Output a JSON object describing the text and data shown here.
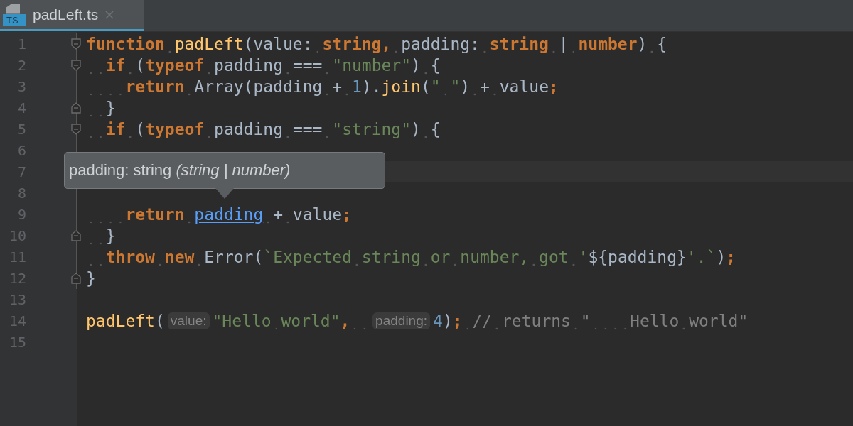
{
  "tabs": [
    {
      "label": "padLeft.ts",
      "icon": "TS",
      "selected": true
    }
  ],
  "lines": [
    {
      "number": "1",
      "fold_start": true,
      "tokens": [
        {
          "text": "function ",
          "kind": "keyword"
        },
        {
          "text": "padLeft",
          "kind": "function"
        },
        {
          "text": "(value: ",
          "kind": "plain"
        },
        {
          "text": "string, ",
          "kind": "keyword"
        },
        {
          "text": "padding: ",
          "kind": "plain"
        },
        {
          "text": "string ",
          "kind": "keyword"
        },
        {
          "text": "| ",
          "kind": "plain"
        },
        {
          "text": "number",
          "kind": "keyword"
        },
        {
          "text": ") {",
          "kind": "plain"
        }
      ]
    },
    {
      "number": "2",
      "fold_start": true,
      "tokens": [
        {
          "text": "  if ",
          "kind": "keyword"
        },
        {
          "text": "(",
          "kind": "plain"
        },
        {
          "text": "typeof ",
          "kind": "keyword"
        },
        {
          "text": "padding === ",
          "kind": "plain"
        },
        {
          "text": "\"number\"",
          "kind": "string"
        },
        {
          "text": ") {",
          "kind": "plain"
        }
      ]
    },
    {
      "number": "3",
      "tokens": [
        {
          "text": "    return ",
          "kind": "keyword"
        },
        {
          "text": "Array(padding + ",
          "kind": "plain"
        },
        {
          "text": "1",
          "kind": "number"
        },
        {
          "text": ").",
          "kind": "plain"
        },
        {
          "text": "join",
          "kind": "function"
        },
        {
          "text": "(",
          "kind": "plain"
        },
        {
          "text": "\" \"",
          "kind": "string"
        },
        {
          "text": ") + value",
          "kind": "plain"
        },
        {
          "text": ";",
          "kind": "keyword"
        }
      ]
    },
    {
      "number": "4",
      "fold_end": true,
      "tokens": [
        {
          "text": "  }",
          "kind": "plain"
        }
      ]
    },
    {
      "number": "5",
      "fold_start": true,
      "tokens": [
        {
          "text": "  if ",
          "kind": "keyword"
        },
        {
          "text": "(",
          "kind": "plain"
        },
        {
          "text": "typeof ",
          "kind": "keyword"
        },
        {
          "text": "padding === ",
          "kind": "plain"
        },
        {
          "text": "\"string\"",
          "kind": "string"
        },
        {
          "text": ") {",
          "kind": "plain"
        }
      ]
    },
    {
      "number": "6"
    },
    {
      "number": "7",
      "current": true
    },
    {
      "number": "8"
    },
    {
      "number": "9",
      "tokens": [
        {
          "text": "    return ",
          "kind": "keyword"
        },
        {
          "text": "padding",
          "kind": "link"
        },
        {
          "text": " + value",
          "kind": "plain"
        },
        {
          "text": ";",
          "kind": "keyword"
        }
      ]
    },
    {
      "number": "10",
      "fold_end": true,
      "tokens": [
        {
          "text": "  }",
          "kind": "plain"
        }
      ]
    },
    {
      "number": "11",
      "tokens": [
        {
          "text": "  throw new ",
          "kind": "keyword"
        },
        {
          "text": "Error(",
          "kind": "plain"
        },
        {
          "text": "`Expected string or number, got '",
          "kind": "string"
        },
        {
          "text": "${padding}",
          "kind": "plain"
        },
        {
          "text": "'.`",
          "kind": "string"
        },
        {
          "text": ")",
          "kind": "plain"
        },
        {
          "text": ";",
          "kind": "keyword"
        }
      ]
    },
    {
      "number": "12",
      "fold_end": true,
      "tokens": [
        {
          "text": "}",
          "kind": "plain"
        }
      ]
    },
    {
      "number": "13"
    },
    {
      "number": "14",
      "tokens": [
        {
          "text": "padLeft",
          "kind": "function"
        },
        {
          "text": "(",
          "kind": "plain"
        },
        {
          "text": "value:",
          "kind": "hint"
        },
        {
          "text": "\"Hello world\"",
          "kind": "string"
        },
        {
          "text": ",  ",
          "kind": "keyword"
        },
        {
          "text": "padding:",
          "kind": "hint"
        },
        {
          "text": "4",
          "kind": "number"
        },
        {
          "text": ")",
          "kind": "plain"
        },
        {
          "text": "; ",
          "kind": "keyword"
        },
        {
          "text": "// returns \"    Hello world\"",
          "kind": "comment"
        }
      ]
    },
    {
      "number": "15"
    }
  ],
  "tooltip": {
    "text": "padding: string",
    "detail": "(string | number)"
  }
}
